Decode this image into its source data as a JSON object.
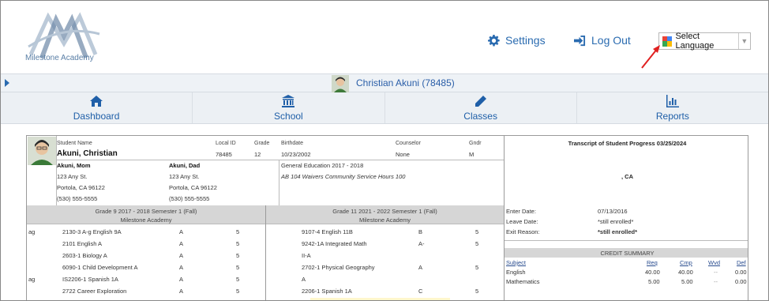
{
  "header": {
    "logo_text": "Milestone Academy",
    "settings_label": "Settings",
    "logout_label": "Log Out",
    "language_select": "Select Language"
  },
  "student_bar": {
    "name": "Christian Akuni (78485)"
  },
  "nav": {
    "items": [
      {
        "label": "Dashboard",
        "icon": "home-icon"
      },
      {
        "label": "School",
        "icon": "school-building-icon"
      },
      {
        "label": "Classes",
        "icon": "pencil-icon"
      },
      {
        "label": "Reports",
        "icon": "bar-chart-icon"
      }
    ]
  },
  "student_info": {
    "labels": {
      "student_name": "Student Name",
      "local_id": "Local ID",
      "grade": "Grade",
      "birthdate": "Birthdate",
      "counselor": "Counselor",
      "gndr": "Gndr"
    },
    "name": "Akuni, Christian",
    "local_id": "78485",
    "grade": "12",
    "birthdate": "10/23/2002",
    "counselor": "None",
    "gender": "M",
    "parents": [
      {
        "name": "Akuni, Mom",
        "address": "123 Any St.",
        "city": "Portola, CA 96122",
        "phone": "(530) 555-5555"
      },
      {
        "name": "Akuni, Dad",
        "address": "123 Any St.",
        "city": "Portola, CA 96122",
        "phone": "(530) 555-5555"
      }
    ],
    "program": "General Education 2017 - 2018",
    "waiver": "AB 104 Waivers Community Service Hours 100"
  },
  "transcript": {
    "title": "Transcript of Student Progress 03/25/2024",
    "school_location": ", CA"
  },
  "semesters": [
    {
      "title": "Grade 9 2017 - 2018 Semester 1 (Fall)",
      "school": "Milestone Academy",
      "courses": [
        {
          "flag": "ag",
          "course": "2130-3 A-g English 9A",
          "grade": "A",
          "credits": "5"
        },
        {
          "flag": "",
          "course": "2101 English A",
          "grade": "A",
          "credits": "5"
        },
        {
          "flag": "",
          "course": "2603-1 Biology A",
          "grade": "A",
          "credits": "5"
        },
        {
          "flag": "",
          "course": "6090-1 Child Development A",
          "grade": "A",
          "credits": "5"
        },
        {
          "flag": "ag",
          "course": "IS2206-1 Spanish 1A",
          "grade": "A",
          "credits": "5"
        },
        {
          "flag": "",
          "course": "2722 Career Exploration",
          "grade": "A",
          "credits": "5"
        }
      ]
    },
    {
      "title": "Grade 11 2021 - 2022 Semester 1 (Fall)",
      "school": "Milestone Academy",
      "courses": [
        {
          "flag": "",
          "course": "9107-4 English 11B",
          "grade": "B",
          "credits": "5"
        },
        {
          "flag": "",
          "course": "9242-1A Integrated Math",
          "grade": "A-",
          "credits": "5"
        },
        {
          "flag": "",
          "course": "II-A",
          "grade": "",
          "credits": ""
        },
        {
          "flag": "",
          "course": "2702-1 Physical Geography",
          "grade": "A",
          "credits": "5"
        },
        {
          "flag": "",
          "course": "A",
          "grade": "",
          "credits": ""
        },
        {
          "flag": "",
          "course": "2206-1 Spanish 1A",
          "grade": "C",
          "credits": "5"
        }
      ]
    }
  ],
  "enrollment": {
    "enter_label": "Enter Date:",
    "enter_value": "07/13/2016",
    "leave_label": "Leave Date:",
    "leave_value": "*still enrolled*",
    "exit_label": "Exit Reason:",
    "exit_value": "*still enrolled*"
  },
  "credit_summary": {
    "title": "CREDIT SUMMARY",
    "headers": [
      "Subject",
      "Req",
      "Cmp",
      "Wvd",
      "Def"
    ],
    "rows": [
      [
        "English",
        "40.00",
        "40.00",
        "--",
        "0.00"
      ],
      [
        "Mathematics",
        "5.00",
        "5.00",
        "--",
        "0.00"
      ]
    ]
  }
}
